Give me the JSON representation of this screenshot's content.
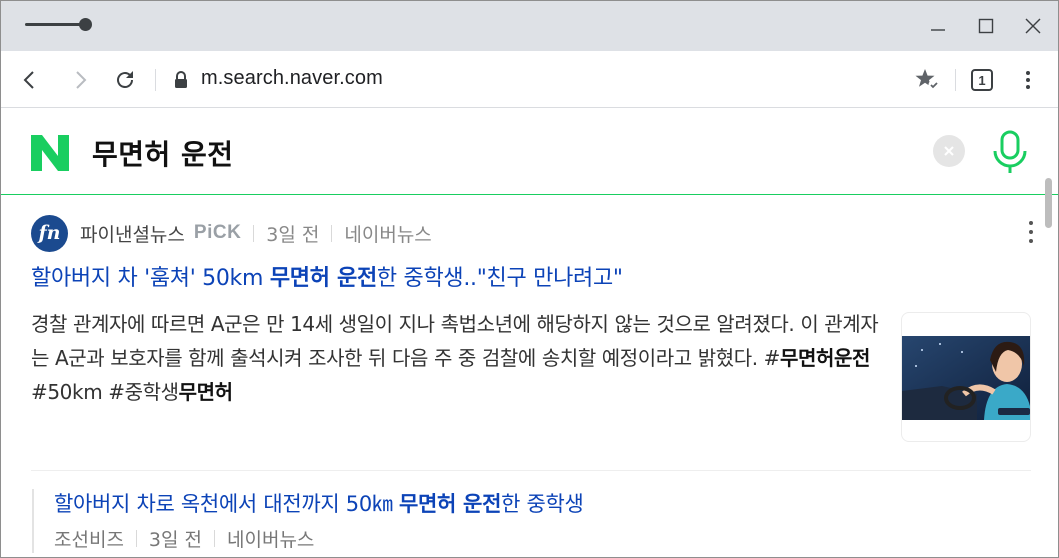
{
  "browser": {
    "url": "m.search.naver.com",
    "tab_count": "1",
    "icons": {
      "back": "back-arrow-icon",
      "forward": "forward-arrow-icon",
      "reload": "reload-icon",
      "lock": "lock-icon",
      "bookmark": "bookmark-star-icon",
      "menu": "kebab-menu-icon"
    }
  },
  "search": {
    "query": "무면허 운전",
    "brand_color": "#19ce60"
  },
  "news_card": {
    "press": "파이낸셜뉴스",
    "pick_badge": "PiCK",
    "time": "3일 전",
    "service": "네이버뉴스",
    "headline_pre": "할아버지 차 '훔쳐' 50km ",
    "headline_bold": "무면허 운전",
    "headline_post": "한 중학생..\"친구 만나려고\"",
    "summary_text": "경찰 관계자에 따르면 A군은 만 14세 생일이 지나 촉법소년에 해당하지 않는 것으로 알려졌다. 이 관계자는 A군과 보호자를 함께 출석시켜 조사한 뒤 다음 주 중 검찰에 송치할 예정이라고 밝혔다. ",
    "summary_tags": [
      {
        "prefix": "#",
        "bold": "무면허운전"
      },
      {
        "prefix": " #50km #중학생",
        "bold": "무면허"
      }
    ],
    "link_color": "#0c43b7"
  },
  "related": {
    "title_pre": "할아버지 차로 옥천에서 대전까지 50㎞ ",
    "title_bold": "무면허 운전",
    "title_post": "한 중학생",
    "press": "조선비즈",
    "time": "3일 전",
    "service": "네이버뉴스"
  }
}
